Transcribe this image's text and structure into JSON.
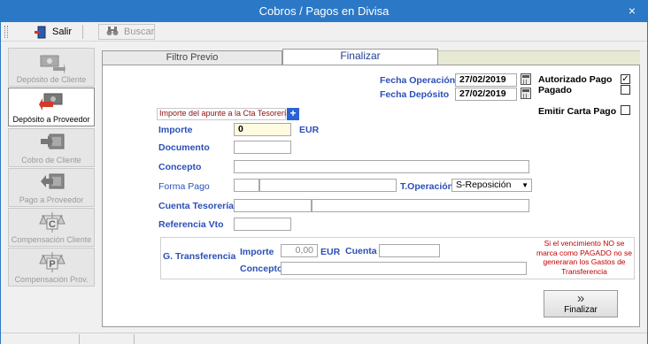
{
  "window": {
    "title": "Cobros / Pagos en Divisa",
    "close": "×"
  },
  "toolbar": {
    "exit_label": "Salir",
    "search_label": "Buscar"
  },
  "sidebar": {
    "items": [
      {
        "label": "Depósito de Cliente",
        "active": false
      },
      {
        "label": "Depósito a Proveedor",
        "active": true
      },
      {
        "label": "Cobro de Cliente",
        "active": false
      },
      {
        "label": "Pago a Proveedor",
        "active": false
      },
      {
        "label": "Compensación Cliente",
        "active": false
      },
      {
        "label": "Compensación Prov.",
        "active": false
      }
    ],
    "comp_client_letter": "C",
    "comp_prov_letter": "P"
  },
  "tabs": [
    {
      "label": "Filtro Previo"
    },
    {
      "label": "Finalizar"
    }
  ],
  "form": {
    "fecha_operacion_label": "Fecha Operación",
    "fecha_operacion_value": "27/02/2019",
    "fecha_deposito_label": "Fecha Depósito",
    "fecha_deposito_value": "27/02/2019",
    "autorizado_label": "Autorizado Pago",
    "autorizado_checked": "✓",
    "pagado_label": "Pagado",
    "emitir_label": "Emitir Carta Pago",
    "importe_apunte_label": "Importe del apunte a la Cta Tesorería",
    "add_symbol": "+",
    "importe_label": "Importe",
    "importe_value": "0",
    "importe_currency": "EUR",
    "documento_label": "Documento",
    "concepto_label": "Concepto",
    "forma_pago_label": "Forma Pago",
    "t_operacion_label": "T.Operación",
    "t_operacion_value": "S-Reposición",
    "cuenta_tesoreria_label": "Cuenta Tesorería",
    "referencia_vto_label": "Referencia Vto"
  },
  "transfer": {
    "g_transferencia_label": "G. Transferencia",
    "importe_label": "Importe",
    "importe_value": "0,00",
    "currency": "EUR",
    "cuenta_label": "Cuenta",
    "concepto_label": "Concepto",
    "note": "Si el vencimiento NO se marca como PAGADO no se generaran los Gastos de Transferencia"
  },
  "finalize_button": {
    "label": "Finalizar",
    "icon": "»"
  },
  "colors": {
    "titlebar": "#2b78c6",
    "label_blue": "#2b4fb8",
    "note_red": "#c00000"
  }
}
